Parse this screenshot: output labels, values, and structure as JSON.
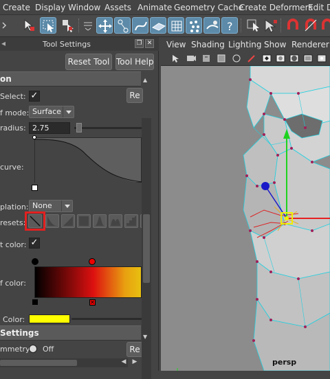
{
  "menubar": {
    "items": [
      "Create",
      "Display",
      "Window",
      "Assets",
      "Animate",
      "Geometry Cache",
      "Create Deformers",
      "Edit De"
    ]
  },
  "tool_settings": {
    "title": "Tool Settings",
    "reset_tool": "Reset Tool",
    "tool_help": "Tool Help",
    "section1": "on",
    "select_label": "Select:",
    "select_checked": "✓",
    "reset_btn": "Re",
    "mode_label": "f mode:",
    "mode_value": "Surface",
    "radius_label": "radius:",
    "radius_value": "2.75",
    "curve_label": "curve:",
    "interp_label": "plation:",
    "interp_value": "None",
    "presets_label": "resets:",
    "color_label": "t color:",
    "color_checked": "✓",
    "falloff_color_label": "f color:",
    "color2_label": "Color:",
    "section2": "Settings",
    "symmetry_label": "mmetry:",
    "symmetry_value": "Off",
    "reset_btn2": "Re",
    "accent_yellow": "#ffff00"
  },
  "viewport": {
    "menu": [
      "View",
      "Shading",
      "Lighting",
      "Show",
      "Renderer"
    ],
    "camera": "persp"
  }
}
